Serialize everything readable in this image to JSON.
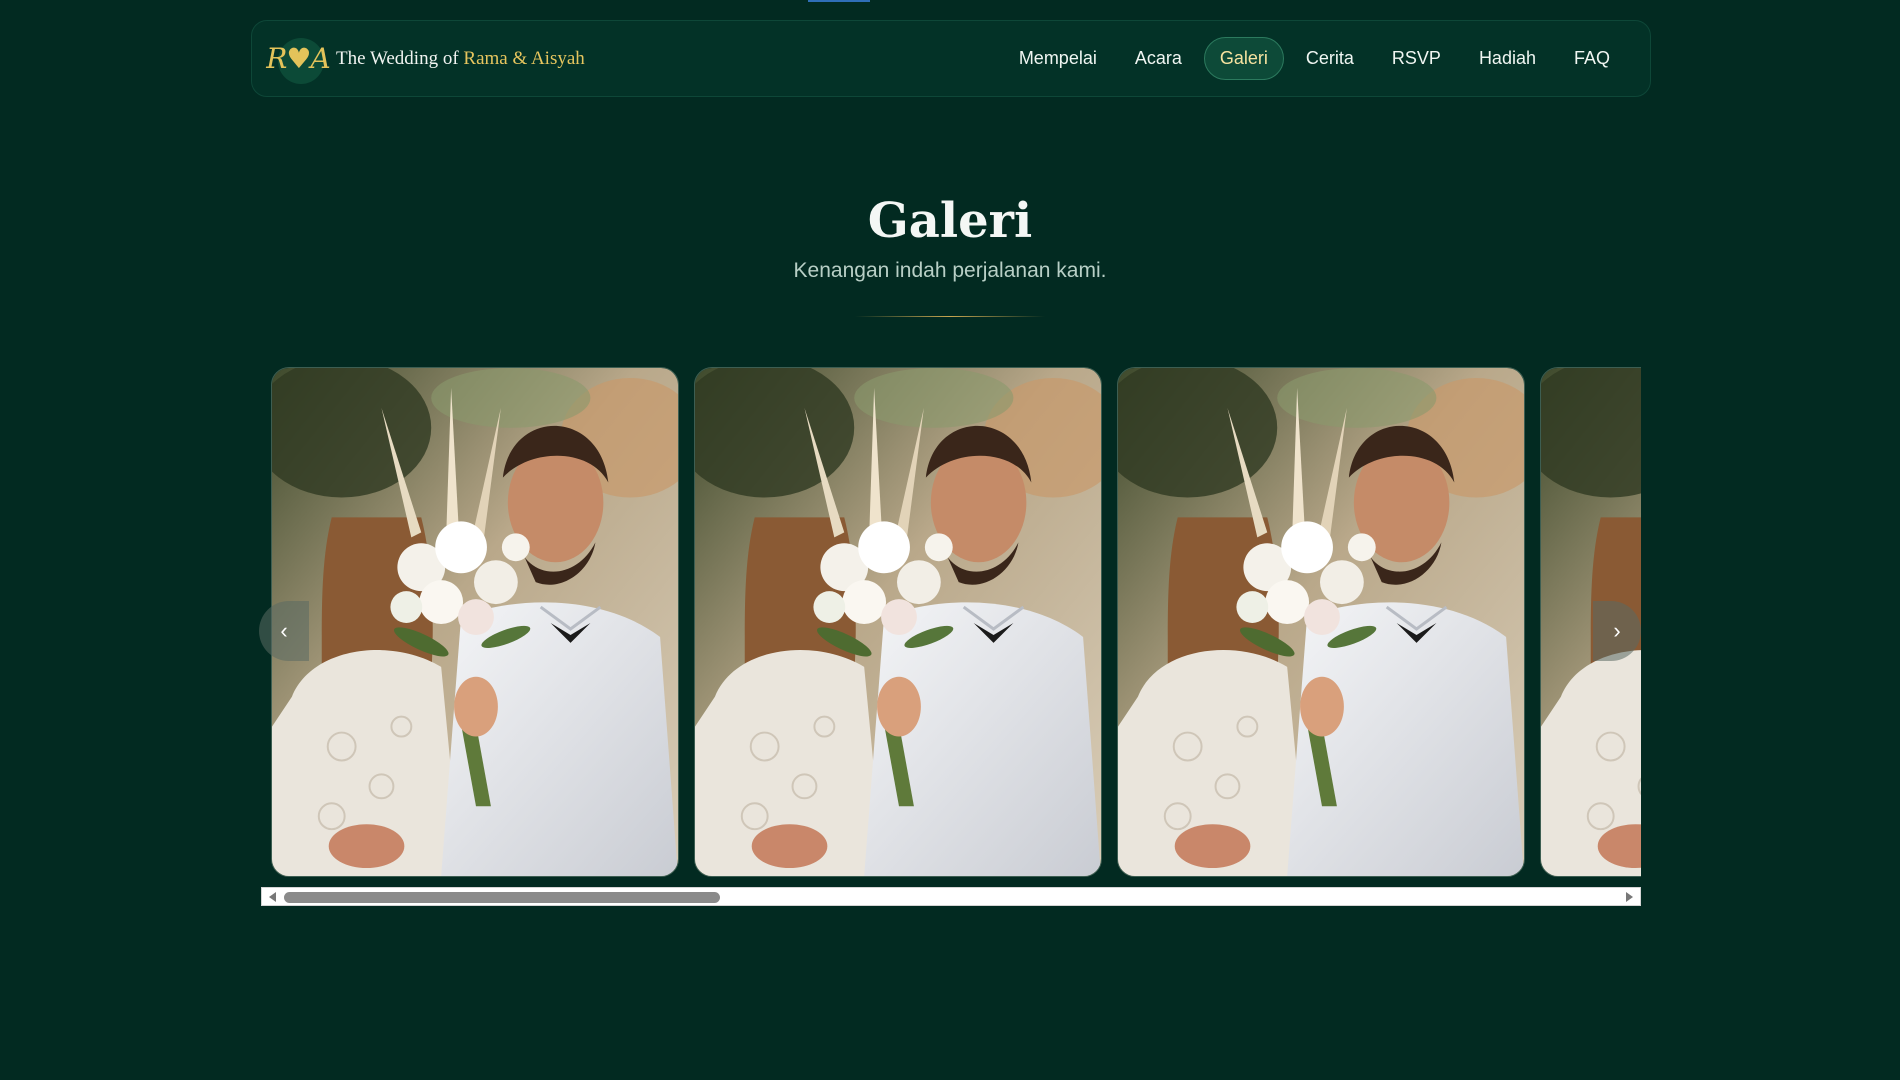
{
  "header": {
    "monogram": "R♥A",
    "title_prefix": "The Wedding of",
    "title_names": "Rama & Aisyah"
  },
  "nav": {
    "items": [
      {
        "label": "Mempelai",
        "active": false
      },
      {
        "label": "Acara",
        "active": false
      },
      {
        "label": "Galeri",
        "active": true
      },
      {
        "label": "Cerita",
        "active": false
      },
      {
        "label": "RSVP",
        "active": false
      },
      {
        "label": "Hadiah",
        "active": false
      },
      {
        "label": "FAQ",
        "active": false
      }
    ]
  },
  "section": {
    "title": "Galeri",
    "subtitle": "Kenangan indah perjalanan kami."
  },
  "gallery": {
    "prev_icon": "‹",
    "next_icon": "›",
    "photo_count_visible": 4
  },
  "colors": {
    "background": "#022a21",
    "accent_gold": "#e6c55e",
    "nav_active_bg": "#0d4a38"
  }
}
